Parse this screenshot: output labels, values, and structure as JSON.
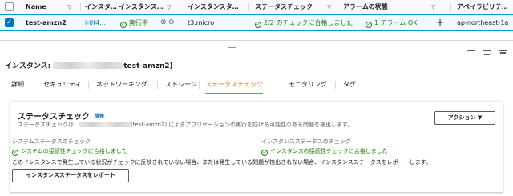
{
  "table": {
    "columns": [
      "Name",
      "インスタ…",
      "インスタンス…",
      "インスタンスタ…",
      "ステータスチェック",
      "アラームの状態",
      "アベイラビリテ…"
    ],
    "row": {
      "name": "test-amzn2",
      "instance_id": "i-0f4…",
      "state": "実行中",
      "instance_type": "t3.micro",
      "status_check": "2/2 のチェックに合格しました",
      "alarm_status": "1 アラーム OK",
      "alarm_add": "+",
      "az": "ap-northeast-1a"
    }
  },
  "detail": {
    "title_prefix": "インスタンス: ",
    "title_suffix": "test-amzn2)",
    "tabs": [
      "詳細",
      "セキュリティ",
      "ネットワーキング",
      "ストレージ",
      "ステータスチェック",
      "モニタリング",
      "タグ"
    ],
    "active_tab": "ステータスチェック"
  },
  "status_card": {
    "title": "ステータスチェック",
    "info_link": "情報",
    "desc_prefix": "ステータスチェックは、",
    "desc_suffix": "(test-amzn2) によるアプリケーションの実行を妨げる可能性のある問題を検出します。",
    "action_button": "アクション ▼",
    "system_label": "システムステータスのチェック",
    "system_value": "システムの接続性チェックに合格しました",
    "instance_label": "インスタンスステータスのチェック",
    "instance_value": "インスタンスの接続性チェックに合格しました",
    "note": "このインスタンスで発生している状況がチェックに反映されていない場合、または発生している問題が検出されない場合、インスタンスステータスをレポートします。",
    "report_button": "インスタンスステータスをレポート"
  },
  "icons": {
    "check": "✓",
    "sort": "▽",
    "zoom_in": "⊕",
    "zoom_out": "⊖"
  },
  "colors": {
    "accent": "#ec7211",
    "link": "#0073bb",
    "success": "#1d8102"
  }
}
